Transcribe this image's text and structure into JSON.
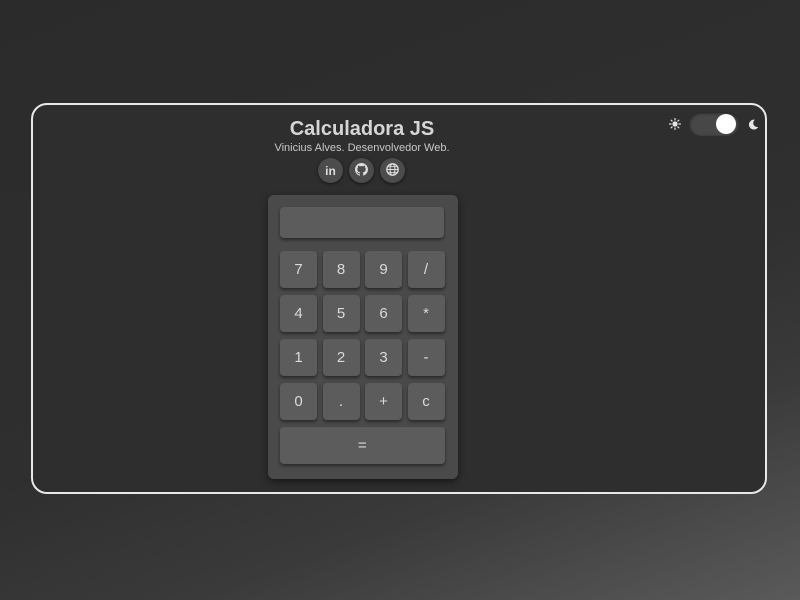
{
  "header": {
    "title": "Calculadora JS",
    "subtitle": "Vinicius Alves. Desenvolvedor Web."
  },
  "socials": [
    {
      "icon": "linkedin-icon",
      "label": "in"
    },
    {
      "icon": "github-icon",
      "label": ""
    },
    {
      "icon": "globe-icon",
      "label": ""
    }
  ],
  "theme": {
    "mode": "dark",
    "toggle_on": true
  },
  "calculator": {
    "display_value": "",
    "keys": [
      {
        "label": "7",
        "name": "key-7"
      },
      {
        "label": "8",
        "name": "key-8"
      },
      {
        "label": "9",
        "name": "key-9"
      },
      {
        "label": "/",
        "name": "key-divide"
      },
      {
        "label": "4",
        "name": "key-4"
      },
      {
        "label": "5",
        "name": "key-5"
      },
      {
        "label": "6",
        "name": "key-6"
      },
      {
        "label": "*",
        "name": "key-multiply"
      },
      {
        "label": "1",
        "name": "key-1"
      },
      {
        "label": "2",
        "name": "key-2"
      },
      {
        "label": "3",
        "name": "key-3"
      },
      {
        "label": "-",
        "name": "key-subtract"
      },
      {
        "label": "0",
        "name": "key-0"
      },
      {
        "label": ".",
        "name": "key-decimal"
      },
      {
        "label": "+",
        "name": "key-add"
      },
      {
        "label": "c",
        "name": "key-clear"
      },
      {
        "label": "=",
        "name": "key-equals"
      }
    ]
  },
  "colors": {
    "background": "#2e2e2e",
    "frame_border": "#e8e8e8",
    "calculator_body": "#4a4a4a",
    "key": "#5c5c5c",
    "text": "#d6d6d6"
  }
}
